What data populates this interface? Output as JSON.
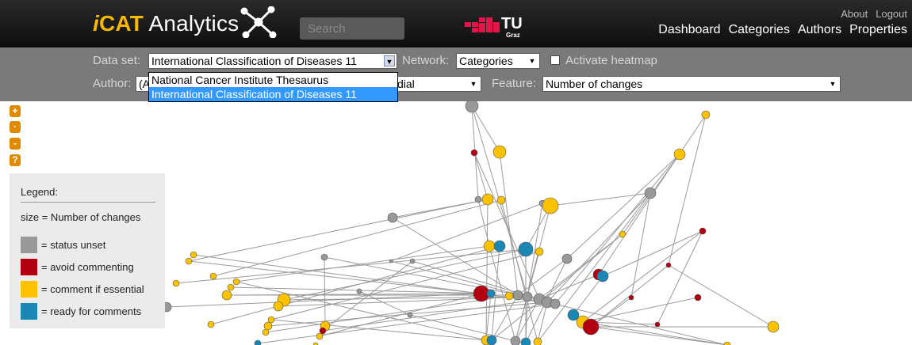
{
  "header": {
    "logo_i": "i",
    "logo_cat": "CAT",
    "logo_rest": " Analytics",
    "search_placeholder": "Search",
    "tu_text": "TU",
    "tu_sub": "Graz",
    "top_links": [
      "About",
      "Logout"
    ],
    "nav": [
      "Dashboard",
      "Categories",
      "Authors",
      "Properties"
    ]
  },
  "toolbar": {
    "dataset_label": "Data set:",
    "dataset_value": "International Classification of Diseases 11",
    "network_label": "Network:",
    "network_value": "Categories",
    "heatmap_label": "Activate heatmap",
    "author_label": "Author:",
    "author_value_visible": "(A",
    "status_value_visible": "dial",
    "feature_label": "Feature:",
    "feature_value": "Number of changes"
  },
  "dropdown_options": [
    {
      "label": "National Cancer Institute Thesaurus",
      "selected": false
    },
    {
      "label": "International Classification of Diseases 11",
      "selected": true
    }
  ],
  "zoom_buttons": [
    "+",
    "·",
    "-",
    "?"
  ],
  "legend": {
    "title": "Legend:",
    "size_text": "size =  Number of changes",
    "items": [
      {
        "label": "= status unset",
        "color": "#999999"
      },
      {
        "label": "= avoid commenting",
        "color": "#b30010"
      },
      {
        "label": "= comment if essential",
        "color": "#fcc200"
      },
      {
        "label": "= ready for comments",
        "color": "#1b87b5"
      }
    ]
  },
  "colors": {
    "unset": "#999999",
    "avoid": "#b30010",
    "essential": "#fcc200",
    "ready": "#1b87b5",
    "edge": "#9a9a9a"
  }
}
